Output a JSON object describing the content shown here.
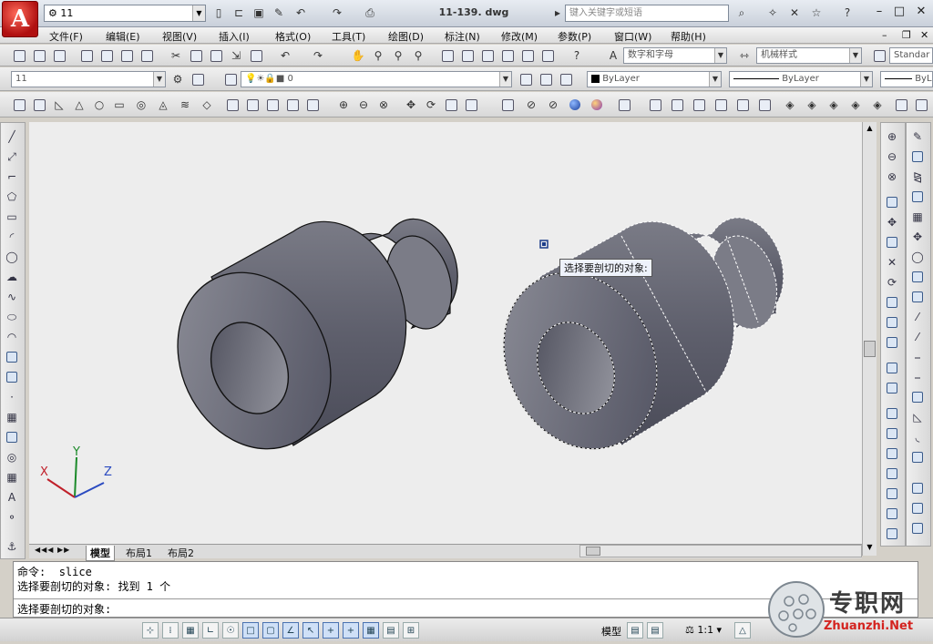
{
  "titlebar": {
    "workspace": "11",
    "doc_title": "11-139. dwg",
    "search_placeholder": "键入关键字或短语"
  },
  "menu": [
    "文件(F)",
    "编辑(E)",
    "视图(V)",
    "插入(I)",
    "格式(O)",
    "工具(T)",
    "绘图(D)",
    "标注(N)",
    "修改(M)",
    "参数(P)",
    "窗口(W)",
    "帮助(H)"
  ],
  "toolbar1": {
    "text_style": "数字和字母",
    "dim_style": "机械样式",
    "table_style": "Standar"
  },
  "toolbar2": {
    "layer_state": "11",
    "current_layer": "0",
    "color": "ByLayer",
    "linetype": "ByLayer",
    "lineweight": "ByL"
  },
  "drawing": {
    "tooltip": "选择要剖切的对象:",
    "ucs": {
      "x": "X",
      "y": "Y",
      "z": "Z"
    },
    "colors": {
      "solid_light": "#8a8b95",
      "solid_dark": "#4e4f5c",
      "background": "#ededed"
    }
  },
  "tabs": {
    "model": "模型",
    "layout1": "布局1",
    "layout2": "布局2"
  },
  "command": {
    "history1_prompt": "命令:",
    "history1_value": "slice",
    "history2": "选择要剖切的对象: 找到 1 个",
    "current": "选择要剖切的对象:"
  },
  "status": {
    "model": "模型",
    "scale": "1:1"
  },
  "watermark": {
    "name": "专职网",
    "url": "Zhuanzhi.Net"
  }
}
